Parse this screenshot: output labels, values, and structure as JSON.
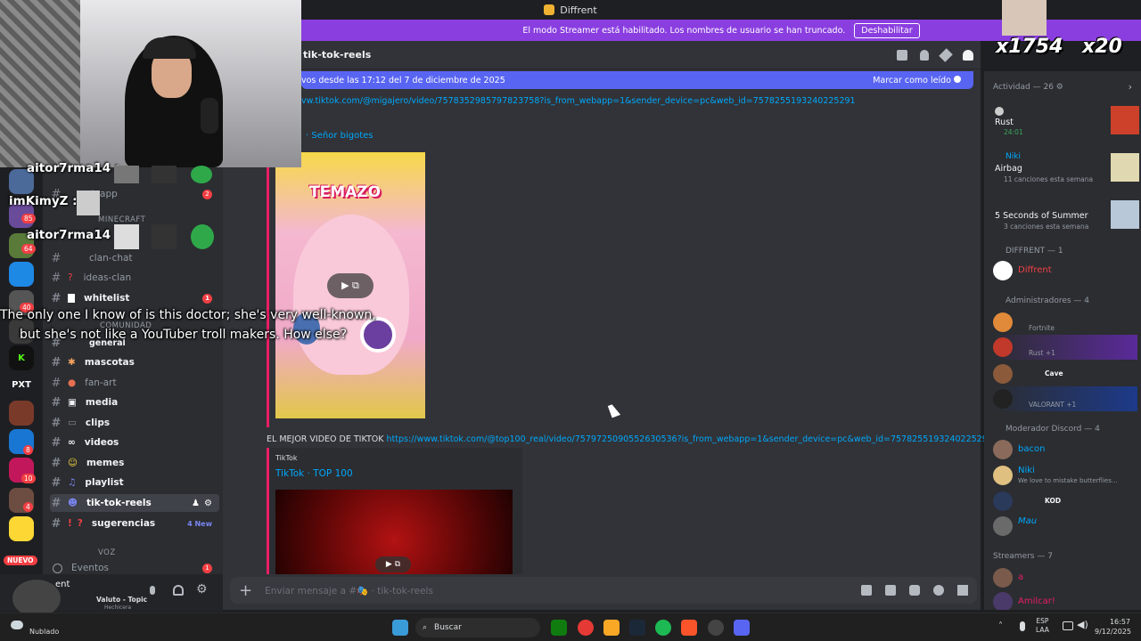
{
  "window": {
    "title": "Diffrent"
  },
  "streamer_banner": {
    "text": "El modo Streamer está habilitado. Los nombres de usuario se han truncado.",
    "button": "Deshabilitar"
  },
  "overlay": {
    "counter_left": "x1754",
    "counter_right": "x20"
  },
  "channel_header": {
    "name": "tik-tok-reels"
  },
  "new_messages": {
    "text": "vos desde las 17:12 del 7 de diciembre de 2025",
    "mark_read": "Marcar como leído"
  },
  "servers": {
    "new_label": "NUEVO",
    "pxt": "PXT",
    "badges": [
      "85",
      "64",
      "40",
      "4",
      "8",
      "10",
      "4"
    ]
  },
  "channels": {
    "categories": {
      "minecraft": "MINECRAFT",
      "comunidad": "COMUNIDAD",
      "voz": "VOZ"
    },
    "items": [
      {
        "name": "clan-chat"
      },
      {
        "name": "ideas-clan"
      },
      {
        "name": "whitelist",
        "count": "1"
      },
      {
        "name": "general"
      },
      {
        "name": "mascotas"
      },
      {
        "name": "fan-art"
      },
      {
        "name": "media"
      },
      {
        "name": "clips"
      },
      {
        "name": "videos"
      },
      {
        "name": "memes"
      },
      {
        "name": "playlist"
      },
      {
        "name": "tik-tok-reels"
      },
      {
        "name": "sugerencias",
        "badge": "4 New"
      }
    ],
    "partial": "atsapp",
    "partial_count": "2",
    "events": "Eventos",
    "events_count": "1"
  },
  "twitch_chat": [
    {
      "user": "aitor7rma14 :"
    },
    {
      "user": "imKimyZ :"
    },
    {
      "user": "aitor7rma14 :"
    }
  ],
  "subtitles": [
    "The only one I know of is this doctor; she's very well-known,",
    "but she's not like a YouTuber troll makers. How else?"
  ],
  "messages": {
    "link1": "vw.tiktok.com/@migajero/video/7578352985797823758?is_from_webapp=1&sender_device=pc&web_id=7578255193240225291",
    "embed1_author": "Señor bigotes",
    "embed1_overlay": "TEMAZO",
    "msg2_text": "EL MEJOR VIDEO DE TIKTOK",
    "msg2_link": "https://www.tiktok.com/@top100_real/video/7579725090552630536?is_from_webapp=1&sender_device=pc&web_id=7578255193240225291",
    "embed2_provider": "TikTok",
    "embed2_title": "TikTok · TOP 100"
  },
  "composer": {
    "placeholder": "Enviar mensaje a #🎭 · tik-tok-reels"
  },
  "user_panel": {
    "name": "ent",
    "status_song": "Valuto - Topic",
    "status_sub": "Hechicera",
    "weather": "Nublado"
  },
  "members": {
    "activity_header": "Actividad — 26",
    "activities": [
      {
        "game": "Rust",
        "detail": "24:01"
      },
      {
        "name": "Niki",
        "game": "Airbag",
        "detail": "11 canciones esta semana"
      },
      {
        "game": "5 Seconds of Summer",
        "detail": "3 canciones esta semana"
      }
    ],
    "groups": [
      {
        "header": "DIFFRENT — 1",
        "members": [
          {
            "name": "Diffrent",
            "status": "",
            "color": "#f23f43"
          }
        ]
      },
      {
        "header": "Administradores — 4",
        "members": [
          {
            "name": "",
            "status": "Fortnite",
            "color": "#5865f2"
          },
          {
            "name": "",
            "status": "Rust +1",
            "color": "#5865f2"
          },
          {
            "name": "",
            "status": "Cave",
            "color": "#5865f2"
          },
          {
            "name": "",
            "status": "VALORANT +1",
            "color": "#5865f2"
          }
        ]
      },
      {
        "header": "Moderador Discord — 4",
        "members": [
          {
            "name": "bacon",
            "status": "",
            "color": "#00a8fc"
          },
          {
            "name": "Niki",
            "status": "We love to mistake butterflies...",
            "color": "#00a8fc"
          },
          {
            "name": "",
            "status": "KOD",
            "color": "#00a8fc"
          },
          {
            "name": "Mau",
            "status": "",
            "color": "#00a8fc"
          }
        ]
      },
      {
        "header": "Streamers — 7",
        "members": [
          {
            "name": "a",
            "status": "",
            "color": "#e91e63"
          },
          {
            "name": "Amilcar!",
            "status": "",
            "color": "#e91e63"
          }
        ]
      }
    ]
  },
  "taskbar": {
    "search": "Buscar",
    "lang1": "ESP",
    "lang2": "LAA",
    "time": "16:57",
    "date": "9/12/2025"
  }
}
